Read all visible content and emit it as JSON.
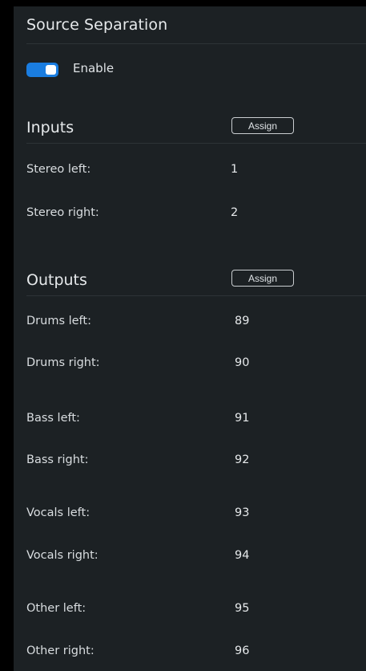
{
  "panel": {
    "title": "Source Separation",
    "enable": {
      "label": "Enable",
      "on": true,
      "color": "#1a7de0"
    }
  },
  "inputs": {
    "title": "Inputs",
    "assign_label": "Assign",
    "rows": [
      {
        "label": "Stereo left:",
        "value": "1"
      },
      {
        "label": "Stereo right:",
        "value": "2"
      }
    ]
  },
  "outputs": {
    "title": "Outputs",
    "assign_label": "Assign",
    "rows": [
      {
        "label": "Drums left:",
        "value": "89"
      },
      {
        "label": "Drums right:",
        "value": "90"
      },
      {
        "label": "Bass left:",
        "value": "91"
      },
      {
        "label": "Bass right:",
        "value": "92"
      },
      {
        "label": "Vocals left:",
        "value": "93"
      },
      {
        "label": "Vocals right:",
        "value": "94"
      },
      {
        "label": "Other left:",
        "value": "95"
      },
      {
        "label": "Other right:",
        "value": "96"
      }
    ]
  }
}
